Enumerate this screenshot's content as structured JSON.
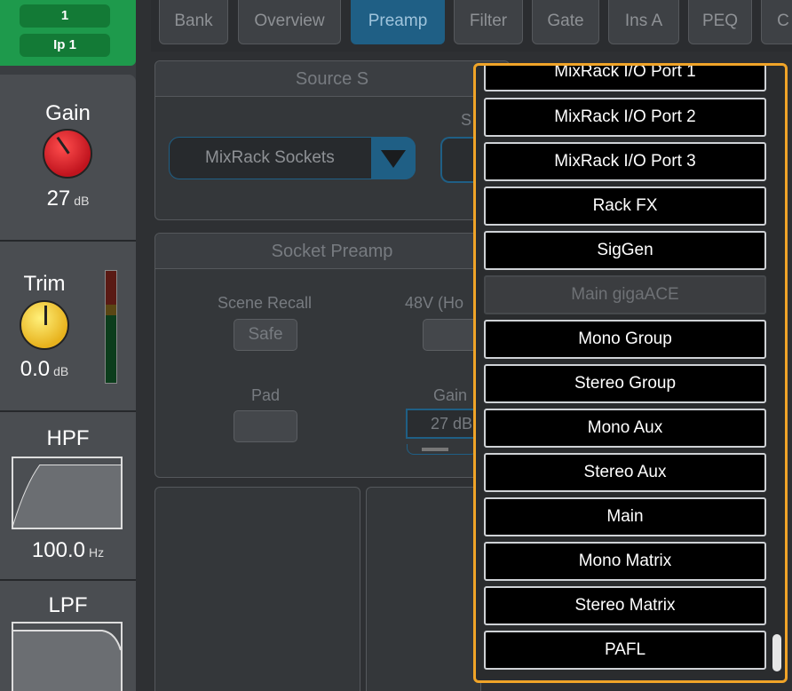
{
  "channel": {
    "number": "1",
    "name": "Ip 1"
  },
  "strip": {
    "gain": {
      "label": "Gain",
      "value": "27",
      "unit": "dB"
    },
    "trim": {
      "label": "Trim",
      "value": "0.0",
      "unit": "dB"
    },
    "hpf": {
      "label": "HPF",
      "value": "100.0",
      "unit": "Hz"
    },
    "lpf": {
      "label": "LPF"
    }
  },
  "tabs": [
    {
      "label": "Bank",
      "active": false
    },
    {
      "label": "Overview",
      "active": false
    },
    {
      "label": "Preamp",
      "active": true
    },
    {
      "label": "Filter",
      "active": false
    },
    {
      "label": "Gate",
      "active": false
    },
    {
      "label": "Ins A",
      "active": false
    },
    {
      "label": "PEQ",
      "active": false
    },
    {
      "label": "C",
      "active": false
    }
  ],
  "source": {
    "title": "Source S",
    "select_label_partial": "S",
    "dropdown_value": "MixRack Sockets"
  },
  "socket_preamp": {
    "title": "Socket Preamp",
    "scene_recall_label": "Scene Recall",
    "safe_label": "Safe",
    "phantom_label": "48V (Ho",
    "pad_label": "Pad",
    "gain_label": "Gain",
    "gain_value": "27 dB"
  },
  "dropdown": {
    "items": [
      {
        "label": "MixRack I/O Port 1",
        "disabled": false
      },
      {
        "label": "MixRack I/O Port 2",
        "disabled": false
      },
      {
        "label": "MixRack I/O Port 3",
        "disabled": false
      },
      {
        "label": "Rack FX",
        "disabled": false
      },
      {
        "label": "SigGen",
        "disabled": false
      },
      {
        "label": "Main gigaACE",
        "disabled": true
      },
      {
        "label": "Mono Group",
        "disabled": false
      },
      {
        "label": "Stereo Group",
        "disabled": false
      },
      {
        "label": "Mono Aux",
        "disabled": false
      },
      {
        "label": "Stereo Aux",
        "disabled": false
      },
      {
        "label": "Main",
        "disabled": false
      },
      {
        "label": "Mono Matrix",
        "disabled": false
      },
      {
        "label": "Stereo Matrix",
        "disabled": false
      },
      {
        "label": "PAFL",
        "disabled": false
      }
    ]
  },
  "colors": {
    "accent": "#f0a428",
    "channel": "#1e9a4c",
    "tab_active": "#1f5f85"
  }
}
